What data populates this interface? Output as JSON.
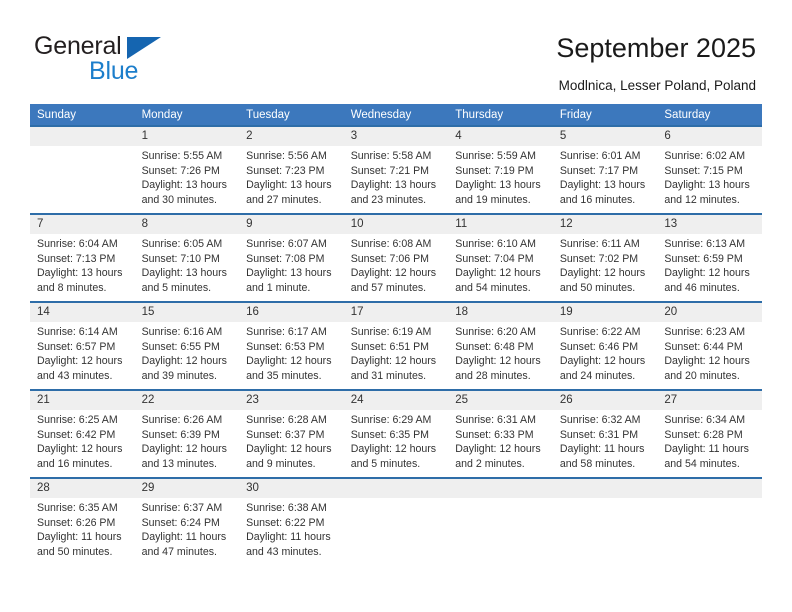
{
  "brand": {
    "name_top": "General",
    "name_bottom": "Blue",
    "accent_color": "#1c7ecb",
    "triangle_color": "#1565b0"
  },
  "header": {
    "title": "September 2025",
    "subtitle": "Modlnica, Lesser Poland, Poland"
  },
  "theme": {
    "header_blue": "#3c78bd",
    "row_border_blue": "#2e6da8",
    "daynum_band": "#efefef"
  },
  "calendar": {
    "weekday_headers": [
      "Sunday",
      "Monday",
      "Tuesday",
      "Wednesday",
      "Thursday",
      "Friday",
      "Saturday"
    ],
    "weeks": [
      [
        {
          "day": "",
          "sunrise": "",
          "sunset": "",
          "daylight": "",
          "empty": true
        },
        {
          "day": "1",
          "sunrise": "Sunrise: 5:55 AM",
          "sunset": "Sunset: 7:26 PM",
          "daylight": "Daylight: 13 hours and 30 minutes."
        },
        {
          "day": "2",
          "sunrise": "Sunrise: 5:56 AM",
          "sunset": "Sunset: 7:23 PM",
          "daylight": "Daylight: 13 hours and 27 minutes."
        },
        {
          "day": "3",
          "sunrise": "Sunrise: 5:58 AM",
          "sunset": "Sunset: 7:21 PM",
          "daylight": "Daylight: 13 hours and 23 minutes."
        },
        {
          "day": "4",
          "sunrise": "Sunrise: 5:59 AM",
          "sunset": "Sunset: 7:19 PM",
          "daylight": "Daylight: 13 hours and 19 minutes."
        },
        {
          "day": "5",
          "sunrise": "Sunrise: 6:01 AM",
          "sunset": "Sunset: 7:17 PM",
          "daylight": "Daylight: 13 hours and 16 minutes."
        },
        {
          "day": "6",
          "sunrise": "Sunrise: 6:02 AM",
          "sunset": "Sunset: 7:15 PM",
          "daylight": "Daylight: 13 hours and 12 minutes."
        }
      ],
      [
        {
          "day": "7",
          "sunrise": "Sunrise: 6:04 AM",
          "sunset": "Sunset: 7:13 PM",
          "daylight": "Daylight: 13 hours and 8 minutes."
        },
        {
          "day": "8",
          "sunrise": "Sunrise: 6:05 AM",
          "sunset": "Sunset: 7:10 PM",
          "daylight": "Daylight: 13 hours and 5 minutes."
        },
        {
          "day": "9",
          "sunrise": "Sunrise: 6:07 AM",
          "sunset": "Sunset: 7:08 PM",
          "daylight": "Daylight: 13 hours and 1 minute."
        },
        {
          "day": "10",
          "sunrise": "Sunrise: 6:08 AM",
          "sunset": "Sunset: 7:06 PM",
          "daylight": "Daylight: 12 hours and 57 minutes."
        },
        {
          "day": "11",
          "sunrise": "Sunrise: 6:10 AM",
          "sunset": "Sunset: 7:04 PM",
          "daylight": "Daylight: 12 hours and 54 minutes."
        },
        {
          "day": "12",
          "sunrise": "Sunrise: 6:11 AM",
          "sunset": "Sunset: 7:02 PM",
          "daylight": "Daylight: 12 hours and 50 minutes."
        },
        {
          "day": "13",
          "sunrise": "Sunrise: 6:13 AM",
          "sunset": "Sunset: 6:59 PM",
          "daylight": "Daylight: 12 hours and 46 minutes."
        }
      ],
      [
        {
          "day": "14",
          "sunrise": "Sunrise: 6:14 AM",
          "sunset": "Sunset: 6:57 PM",
          "daylight": "Daylight: 12 hours and 43 minutes."
        },
        {
          "day": "15",
          "sunrise": "Sunrise: 6:16 AM",
          "sunset": "Sunset: 6:55 PM",
          "daylight": "Daylight: 12 hours and 39 minutes."
        },
        {
          "day": "16",
          "sunrise": "Sunrise: 6:17 AM",
          "sunset": "Sunset: 6:53 PM",
          "daylight": "Daylight: 12 hours and 35 minutes."
        },
        {
          "day": "17",
          "sunrise": "Sunrise: 6:19 AM",
          "sunset": "Sunset: 6:51 PM",
          "daylight": "Daylight: 12 hours and 31 minutes."
        },
        {
          "day": "18",
          "sunrise": "Sunrise: 6:20 AM",
          "sunset": "Sunset: 6:48 PM",
          "daylight": "Daylight: 12 hours and 28 minutes."
        },
        {
          "day": "19",
          "sunrise": "Sunrise: 6:22 AM",
          "sunset": "Sunset: 6:46 PM",
          "daylight": "Daylight: 12 hours and 24 minutes."
        },
        {
          "day": "20",
          "sunrise": "Sunrise: 6:23 AM",
          "sunset": "Sunset: 6:44 PM",
          "daylight": "Daylight: 12 hours and 20 minutes."
        }
      ],
      [
        {
          "day": "21",
          "sunrise": "Sunrise: 6:25 AM",
          "sunset": "Sunset: 6:42 PM",
          "daylight": "Daylight: 12 hours and 16 minutes."
        },
        {
          "day": "22",
          "sunrise": "Sunrise: 6:26 AM",
          "sunset": "Sunset: 6:39 PM",
          "daylight": "Daylight: 12 hours and 13 minutes."
        },
        {
          "day": "23",
          "sunrise": "Sunrise: 6:28 AM",
          "sunset": "Sunset: 6:37 PM",
          "daylight": "Daylight: 12 hours and 9 minutes."
        },
        {
          "day": "24",
          "sunrise": "Sunrise: 6:29 AM",
          "sunset": "Sunset: 6:35 PM",
          "daylight": "Daylight: 12 hours and 5 minutes."
        },
        {
          "day": "25",
          "sunrise": "Sunrise: 6:31 AM",
          "sunset": "Sunset: 6:33 PM",
          "daylight": "Daylight: 12 hours and 2 minutes."
        },
        {
          "day": "26",
          "sunrise": "Sunrise: 6:32 AM",
          "sunset": "Sunset: 6:31 PM",
          "daylight": "Daylight: 11 hours and 58 minutes."
        },
        {
          "day": "27",
          "sunrise": "Sunrise: 6:34 AM",
          "sunset": "Sunset: 6:28 PM",
          "daylight": "Daylight: 11 hours and 54 minutes."
        }
      ],
      [
        {
          "day": "28",
          "sunrise": "Sunrise: 6:35 AM",
          "sunset": "Sunset: 6:26 PM",
          "daylight": "Daylight: 11 hours and 50 minutes."
        },
        {
          "day": "29",
          "sunrise": "Sunrise: 6:37 AM",
          "sunset": "Sunset: 6:24 PM",
          "daylight": "Daylight: 11 hours and 47 minutes."
        },
        {
          "day": "30",
          "sunrise": "Sunrise: 6:38 AM",
          "sunset": "Sunset: 6:22 PM",
          "daylight": "Daylight: 11 hours and 43 minutes."
        },
        {
          "day": "",
          "sunrise": "",
          "sunset": "",
          "daylight": "",
          "empty": true
        },
        {
          "day": "",
          "sunrise": "",
          "sunset": "",
          "daylight": "",
          "empty": true
        },
        {
          "day": "",
          "sunrise": "",
          "sunset": "",
          "daylight": "",
          "empty": true
        },
        {
          "day": "",
          "sunrise": "",
          "sunset": "",
          "daylight": "",
          "empty": true
        }
      ]
    ]
  }
}
